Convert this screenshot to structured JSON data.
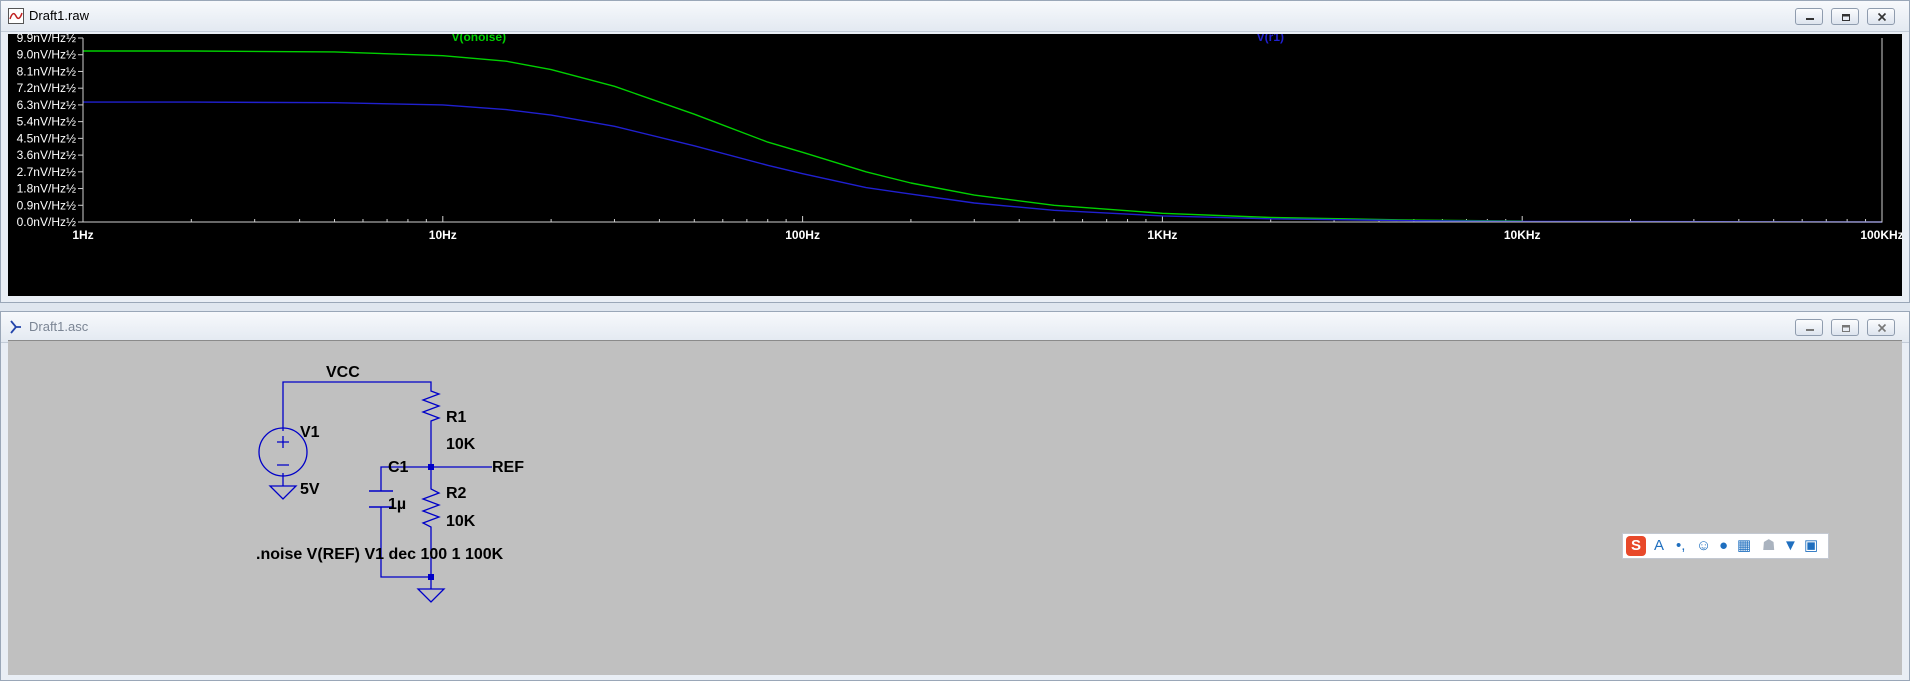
{
  "plot_window": {
    "title": "Draft1.raw",
    "trace_labels": [
      "V(onoise)",
      "V(r1)"
    ],
    "y_ticks": [
      "9.9nV/Hz½",
      "9.0nV/Hz½",
      "8.1nV/Hz½",
      "7.2nV/Hz½",
      "6.3nV/Hz½",
      "5.4nV/Hz½",
      "4.5nV/Hz½",
      "3.6nV/Hz½",
      "2.7nV/Hz½",
      "1.8nV/Hz½",
      "0.9nV/Hz½",
      "0.0nV/Hz½"
    ],
    "x_ticks": [
      "1Hz",
      "10Hz",
      "100Hz",
      "1KHz",
      "10KHz",
      "100KHz"
    ]
  },
  "schematic_window": {
    "title": "Draft1.asc",
    "labels": {
      "vcc": "VCC",
      "v1": "V1",
      "v1_value": "5V",
      "r1": "R1",
      "r1_value": "10K",
      "r2": "R2",
      "r2_value": "10K",
      "c1": "C1",
      "c1_value": "1µ",
      "ref": "REF",
      "directive": ".noise V(REF) V1 dec 100 1 100K"
    }
  },
  "ime_toolbar": {
    "icons": [
      "sogou-logo-icon",
      "font-icon",
      "punctuation-icon",
      "emoji-icon",
      "microphone-icon",
      "keyboard-icon",
      "user-icon",
      "skin-icon",
      "toolbox-icon"
    ]
  },
  "colors": {
    "trace1": "#00d000",
    "trace2": "#2020d0",
    "axis_text": "#ffffff",
    "wire": "#0000c8",
    "schematic_bg": "#c0c0c0"
  },
  "chart_data": {
    "type": "line",
    "x_scale": "log",
    "x_unit": "Hz",
    "y_unit": "nV/Hz½",
    "xlim": [
      1,
      100000
    ],
    "ylim": [
      0,
      9.9
    ],
    "grid": false,
    "legend": "top, centered over each trace",
    "series": [
      {
        "name": "V(onoise)",
        "color": "#00d000",
        "x": [
          1,
          2,
          5,
          10,
          15,
          20,
          30,
          50,
          80,
          100,
          150,
          200,
          300,
          500,
          1000,
          2000,
          5000,
          10000
        ],
        "y": [
          9.2,
          9.2,
          9.15,
          8.95,
          8.65,
          8.2,
          7.3,
          5.8,
          4.3,
          3.75,
          2.7,
          2.1,
          1.45,
          0.9,
          0.47,
          0.24,
          0.1,
          0.05
        ]
      },
      {
        "name": "V(r1)",
        "color": "#2020d0",
        "x": [
          1,
          2,
          5,
          10,
          15,
          20,
          30,
          50,
          80,
          100,
          150,
          200,
          300,
          500,
          1000,
          2000,
          5000,
          10000,
          100000
        ],
        "y": [
          6.45,
          6.45,
          6.42,
          6.3,
          6.05,
          5.75,
          5.15,
          4.1,
          3.05,
          2.6,
          1.85,
          1.5,
          1.02,
          0.63,
          0.33,
          0.17,
          0.07,
          0.03,
          0.0
        ]
      }
    ]
  }
}
